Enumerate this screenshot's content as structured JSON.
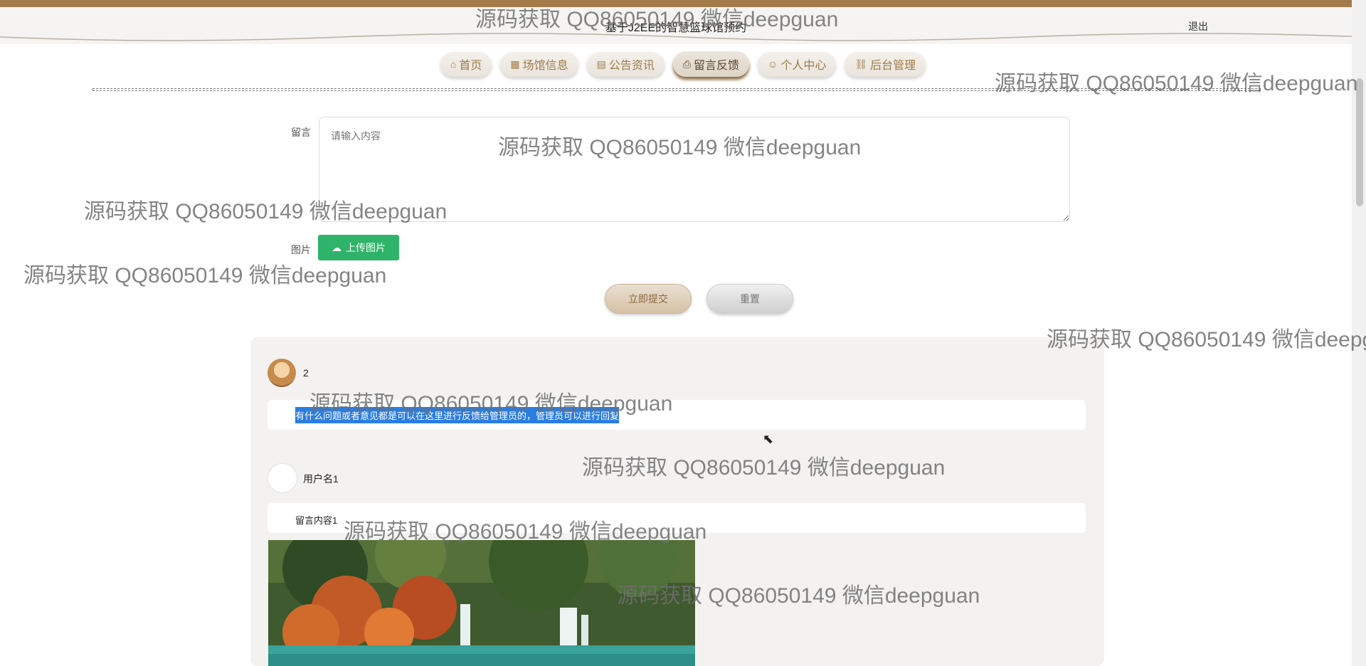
{
  "header": {
    "title": "基于J2EE的智慧篮球馆预约",
    "logout_label": "退出"
  },
  "nav": [
    {
      "icon": "home-icon",
      "glyph": "⌂",
      "label": "首页"
    },
    {
      "icon": "venue-icon",
      "glyph": "▦",
      "label": "场馆信息"
    },
    {
      "icon": "announcement-icon",
      "glyph": "▤",
      "label": "公告资讯"
    },
    {
      "icon": "feedback-icon",
      "glyph": "⎙",
      "label": "留言反馈",
      "active": true
    },
    {
      "icon": "user-icon",
      "glyph": "☺",
      "label": "个人中心"
    },
    {
      "icon": "link-icon",
      "glyph": "⛓",
      "label": "后台管理"
    }
  ],
  "form": {
    "message_label": "留言",
    "message_placeholder": "请输入内容",
    "image_label": "图片",
    "upload_label": "上传图片",
    "submit_label": "立即提交",
    "reset_label": "重置"
  },
  "comments": [
    {
      "username": "2",
      "content": "有什么问题或者意见都是可以在这里进行反馈给管理员的，管理员可以进行回复"
    },
    {
      "username": "用户名1",
      "content": "留言内容1"
    }
  ],
  "watermark": "源码获取 QQ86050149 微信deepguan"
}
